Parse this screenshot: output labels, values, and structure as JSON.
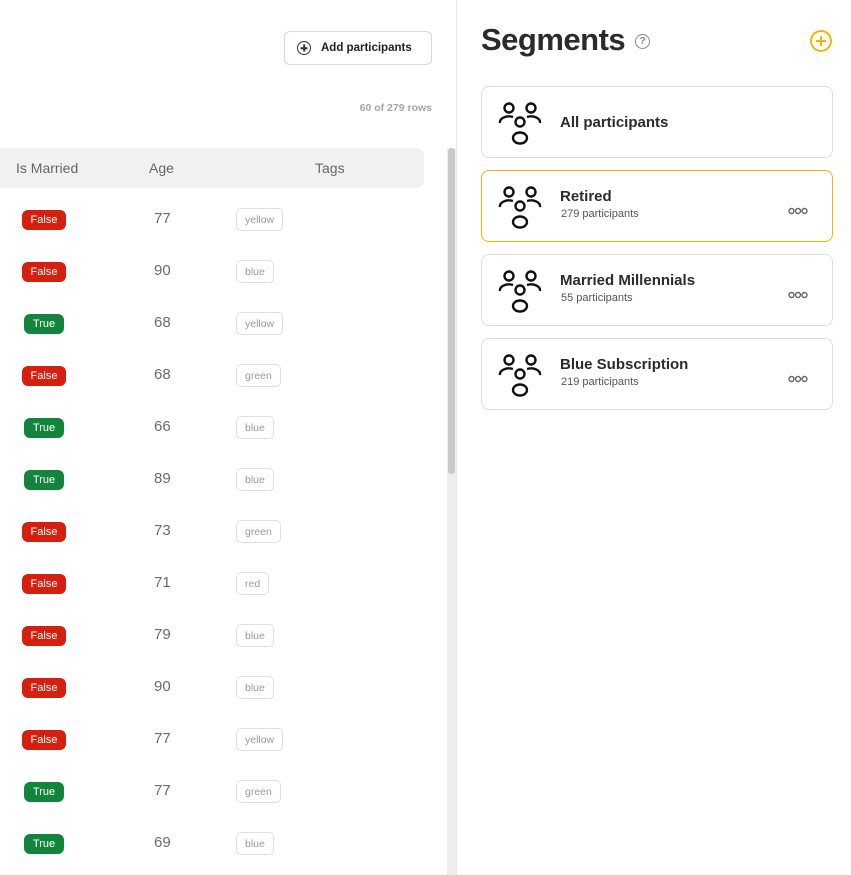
{
  "toolbar": {
    "add_participants_label": "Add participants",
    "row_count": "60 of 279 rows"
  },
  "table": {
    "columns": {
      "is_married": "Is Married",
      "age": "Age",
      "tags": "Tags"
    },
    "rows": [
      {
        "married": "False",
        "age": "77",
        "tag": "yellow"
      },
      {
        "married": "False",
        "age": "90",
        "tag": "blue"
      },
      {
        "married": "True",
        "age": "68",
        "tag": "yellow"
      },
      {
        "married": "False",
        "age": "68",
        "tag": "green"
      },
      {
        "married": "True",
        "age": "66",
        "tag": "blue"
      },
      {
        "married": "True",
        "age": "89",
        "tag": "blue"
      },
      {
        "married": "False",
        "age": "73",
        "tag": "green"
      },
      {
        "married": "False",
        "age": "71",
        "tag": "red"
      },
      {
        "married": "False",
        "age": "79",
        "tag": "blue"
      },
      {
        "married": "False",
        "age": "90",
        "tag": "blue"
      },
      {
        "married": "False",
        "age": "77",
        "tag": "yellow"
      },
      {
        "married": "True",
        "age": "77",
        "tag": "green"
      },
      {
        "married": "True",
        "age": "69",
        "tag": "blue"
      }
    ]
  },
  "segments": {
    "title": "Segments",
    "help_glyph": "?",
    "items": [
      {
        "name": "All participants",
        "count": "",
        "selected": false
      },
      {
        "name": "Retired",
        "count": "279 participants",
        "selected": true
      },
      {
        "name": "Married Millennials",
        "count": "55 participants",
        "selected": false
      },
      {
        "name": "Blue Subscription",
        "count": "219 participants",
        "selected": false
      }
    ]
  },
  "colors": {
    "false_badge": "#d6200f",
    "true_badge": "#12843c",
    "accent": "#f2b705"
  },
  "icons": {
    "add": "plus-circle-icon",
    "help": "help-circle-icon",
    "segment": "people-group-icon",
    "more": "more-dots-icon"
  }
}
